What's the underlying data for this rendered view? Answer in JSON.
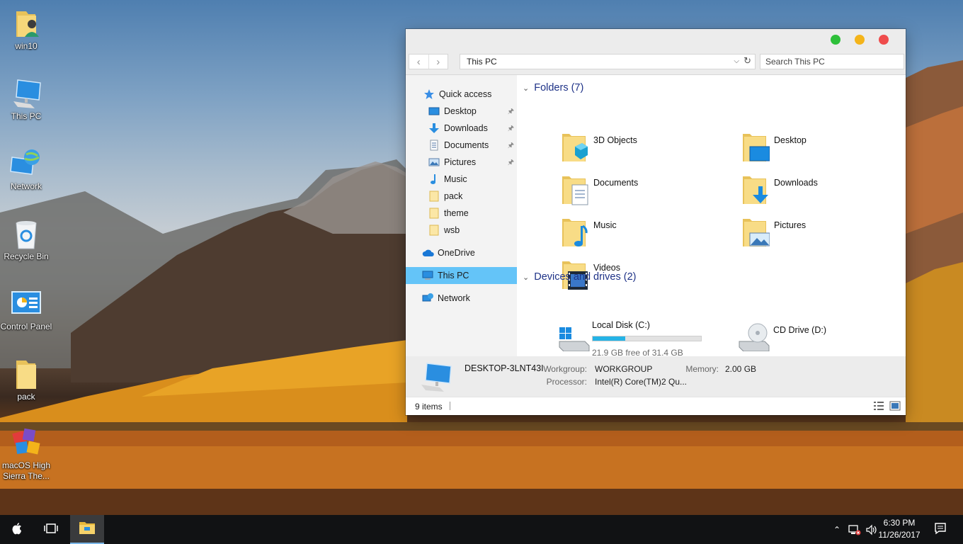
{
  "desktop": {
    "icons": [
      {
        "label": "win10",
        "icon": "user-folder-icon"
      },
      {
        "label": "This PC",
        "icon": "computer-icon"
      },
      {
        "label": "Network",
        "icon": "network-icon"
      },
      {
        "label": "Recycle Bin",
        "icon": "recycle-bin-icon"
      },
      {
        "label": "Control Panel",
        "icon": "control-panel-icon"
      },
      {
        "label": "pack",
        "icon": "folder-icon"
      },
      {
        "label": "macOS High Sierra The...",
        "icon": "installer-icon"
      }
    ]
  },
  "window": {
    "title_buttons": {
      "maximize_color": "#2ec03a",
      "minimize_color": "#f4b41a",
      "close_color": "#ef4c4c"
    },
    "toolbar": {
      "back": "‹",
      "forward": "›",
      "address": "This PC",
      "search_placeholder": "Search This PC"
    },
    "sidebar": {
      "items": [
        {
          "label": "Quick access",
          "icon": "star-icon",
          "pinned": false
        },
        {
          "label": "Desktop",
          "icon": "desktop-icon",
          "pinned": true
        },
        {
          "label": "Downloads",
          "icon": "download-arrow-icon",
          "pinned": true
        },
        {
          "label": "Documents",
          "icon": "document-icon",
          "pinned": true
        },
        {
          "label": "Pictures",
          "icon": "picture-icon",
          "pinned": true
        },
        {
          "label": "Music",
          "icon": "music-note-icon",
          "pinned": false
        },
        {
          "label": "pack",
          "icon": "folder-icon",
          "pinned": false
        },
        {
          "label": "theme",
          "icon": "folder-icon",
          "pinned": false
        },
        {
          "label": "wsb",
          "icon": "folder-icon",
          "pinned": false
        },
        {
          "label": "OneDrive",
          "icon": "cloud-icon",
          "pinned": false
        },
        {
          "label": "This PC",
          "icon": "computer-icon",
          "pinned": false,
          "selected": true
        },
        {
          "label": "Network",
          "icon": "network-icon",
          "pinned": false
        }
      ]
    },
    "content": {
      "folders_header": "Folders (7)",
      "folders": [
        {
          "label": "3D Objects",
          "icon": "cube-folder-icon"
        },
        {
          "label": "Desktop",
          "icon": "desktop-folder-icon"
        },
        {
          "label": "Documents",
          "icon": "documents-folder-icon"
        },
        {
          "label": "Downloads",
          "icon": "downloads-folder-icon"
        },
        {
          "label": "Music",
          "icon": "music-folder-icon"
        },
        {
          "label": "Pictures",
          "icon": "pictures-folder-icon"
        },
        {
          "label": "Videos",
          "icon": "videos-folder-icon"
        }
      ],
      "drives_header": "Devices and drives (2)",
      "drives": [
        {
          "label": "Local Disk (C:)",
          "free": "21.9 GB free of 31.4 GB",
          "used_fraction": 0.3
        },
        {
          "label": "CD Drive (D:)"
        }
      ]
    },
    "details": {
      "pc_name": "DESKTOP-3LNT43I",
      "workgroup_label": "Workgroup:",
      "workgroup": "WORKGROUP",
      "memory_label": "Memory:",
      "memory": "2.00 GB",
      "processor_label": "Processor:",
      "processor": "Intel(R) Core(TM)2 Qu..."
    },
    "statusbar": {
      "count": "9 items"
    }
  },
  "taskbar": {
    "clock_time": "6:30 PM",
    "clock_date": "11/26/2017"
  }
}
